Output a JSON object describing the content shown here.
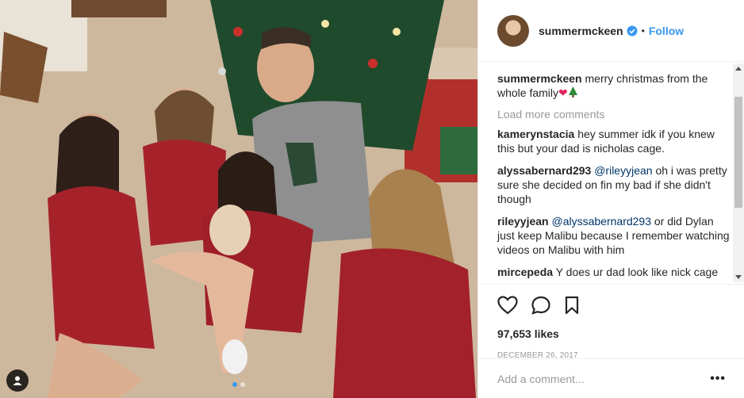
{
  "post": {
    "username": "summermckeen",
    "verified": true,
    "follow_label": "Follow",
    "separator": "•",
    "caption": {
      "user": "summermckeen",
      "text": "merry christmas from the whole family",
      "emojis": [
        "heart",
        "christmas-tree"
      ]
    },
    "load_more_label": "Load more comments",
    "comments": [
      {
        "user": "kamerynstacia",
        "text": "hey summer idk if you knew this but your dad is nicholas cage."
      },
      {
        "user": "alyssabernard293",
        "mention": "@rileyyjean",
        "text": "oh i was pretty sure she decided on fin my bad if she didn't though"
      },
      {
        "user": "rileyyjean",
        "mention": "@alyssabernard293",
        "text": "or did Dylan just keep Malibu because I remember watching videos on Malibu with him"
      },
      {
        "user": "mircepeda",
        "text": "Y does ur dad look like nick cage"
      }
    ],
    "likes": "97,653 likes",
    "date": "DECEMBER 26, 2017",
    "add_comment_placeholder": "Add a comment...",
    "more_options": "•••",
    "carousel": {
      "count": 2,
      "active_index": 1
    },
    "photo_description_icons": [
      "tag-user-icon"
    ]
  },
  "colors": {
    "link": "#3897f0",
    "text": "#262626",
    "muted": "#999999",
    "border": "#efefef",
    "mention": "#003569"
  }
}
